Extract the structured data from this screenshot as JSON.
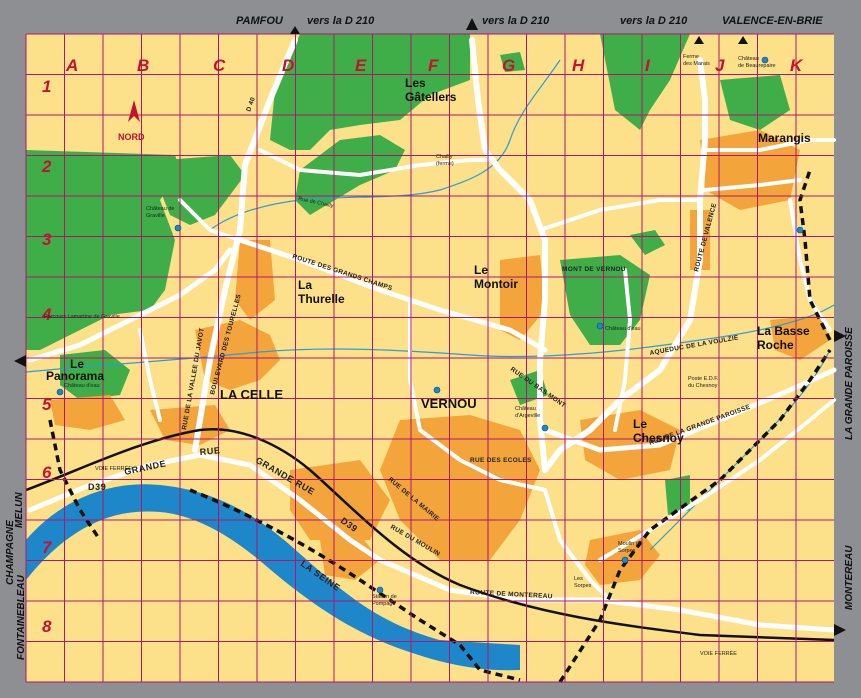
{
  "destinations": {
    "top_pamfou": "PAMFOU",
    "top_d210_1": "vers la D 210",
    "top_d210_2": "vers la D 210",
    "top_d210_3": "vers la D 210",
    "top_valence": "VALENCE-EN-BRIE",
    "right_grande_paroisse": "LA GRANDE PAROISSE",
    "right_montereau": "MONTEREAU",
    "left_melun": "MELUN",
    "left_champagne": "CHAMPAGNE",
    "left_fontainebleau": "FONTAINEBLEAU"
  },
  "grid": {
    "columns": [
      "A",
      "B",
      "C",
      "D",
      "E",
      "F",
      "G",
      "H",
      "I",
      "J",
      "K"
    ],
    "rows": [
      "1",
      "2",
      "3",
      "4",
      "5",
      "6",
      "7",
      "8"
    ]
  },
  "compass": {
    "label": "NORD"
  },
  "places": {
    "gatellers": "Les\nGâtellers",
    "marangis": "Marangis",
    "montoir": "Le\nMontoir",
    "thurelle": "La\nThurelle",
    "basse_roche": "La Basse\nRoche",
    "panorama": "Le\nPanorama",
    "la_celle": "LA CELLE",
    "vernou": "VERNOU",
    "chesnoy": "Le\nChesnoy",
    "sorpes": "Les\nSorpes",
    "mont_vernou": "MONT DE VERNOU"
  },
  "streets": {
    "route_grands_champs": "ROUTE DES GRANDS CHAMPS",
    "route_valence": "ROUTE DE VALENCE",
    "route_montereau": "ROUTE DE MONTEREAU",
    "grande_rue_1": "GRANDE",
    "grande_rue_2": "RUE",
    "grande_rue_3": "GRANDE RUE",
    "rue_chesnoy": "RUE DE LA GRANDE PAROISSE",
    "aqueduc": "AQUEDUC DE LA VOULZIE",
    "d39": "D39",
    "d40": "D 40",
    "d39_2": "D39",
    "vallee_javot": "RUE DE LA VALLEE DU JAVOT",
    "bd_tourelles": "BOULEVARD DES TOURELLES",
    "rue_chailly": "Rue de Chailly",
    "voie_ferree": "VOIE FERRÉE",
    "voie_ferree_2": "VOIE FERRÉE",
    "la_seine": "LA SEINE",
    "rue_du_bas_mont": "RUE DU BAS MONT",
    "rue_de_la_mairie": "RUE DE LA MAIRIE",
    "rue_des_ecoles": "RUE DES ECOLES",
    "rue_du_moulin": "RUE DU MOULIN",
    "parcours": "Parcours Lamartine de Graville"
  },
  "pois": {
    "chateau_graville": "Château de\nGraville",
    "chateau_eau_1": "Château d'eau",
    "chateau_eau_2": "Château d'eau",
    "chateau_argeville": "Château\nd'Argeville",
    "chateau_beaurepaire": "Château\nde Beaurepaire",
    "ferme_marais": "Ferme\ndes Marais",
    "ferme_chailly": "Chailly\n(ferme)",
    "poste_edf": "Poste E.D.F.\ndu Chesnoy",
    "moulin_sorpes": "Moulin de\nSorpes",
    "station_pompage": "Station de\nPompage"
  },
  "colors": {
    "background": "#fde08a",
    "forest": "#3fae49",
    "urban": "#f3a53b",
    "river": "#1d87c9",
    "grid": "#b0156f",
    "road": "#ffffff",
    "label_red": "#c4122f"
  }
}
